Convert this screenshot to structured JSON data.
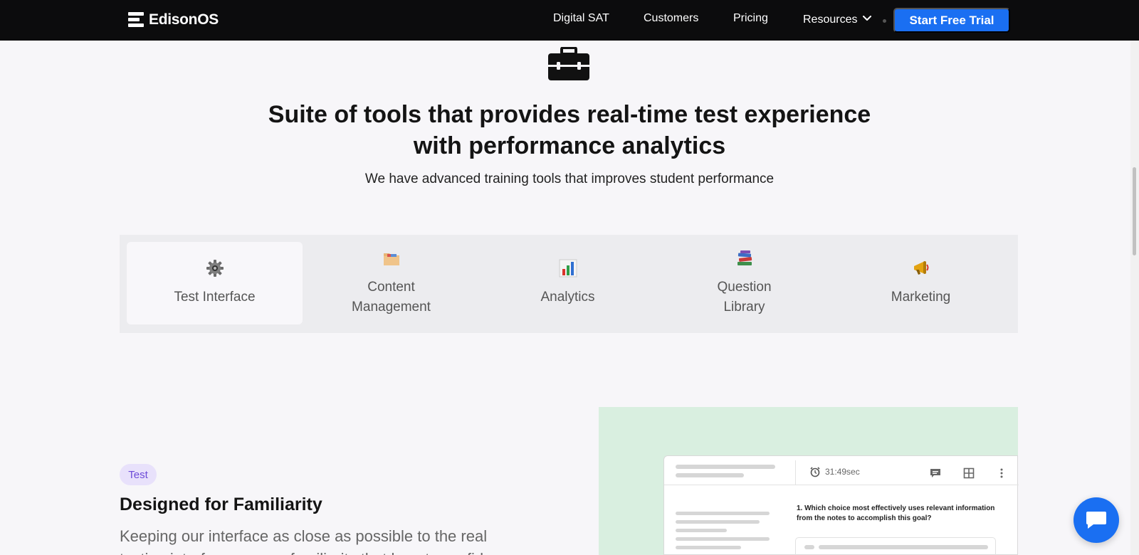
{
  "brand": {
    "name": "EdisonOS"
  },
  "nav": {
    "links": [
      "Digital SAT",
      "Customers",
      "Pricing",
      "Resources"
    ],
    "cta_label": "Start Free Trial"
  },
  "hero": {
    "headline_line1": "Suite of tools that provides real-time test experience",
    "headline_line2": "with performance analytics",
    "subheadline": "We have advanced training tools that improves student performance"
  },
  "tabs": [
    {
      "label_line1": "Test Interface",
      "label_line2": "",
      "icon": "gear-icon",
      "active": true
    },
    {
      "label_line1": "Content",
      "label_line2": "Management",
      "icon": "folder-icon",
      "active": false
    },
    {
      "label_line1": "Analytics",
      "label_line2": "",
      "icon": "bar-chart-icon",
      "active": false
    },
    {
      "label_line1": "Question",
      "label_line2": "Library",
      "icon": "books-icon",
      "active": false
    },
    {
      "label_line1": "Marketing",
      "label_line2": "",
      "icon": "megaphone-icon",
      "active": false
    }
  ],
  "feature": {
    "tag": "Test",
    "title": "Designed for Familiarity",
    "body": "Keeping our interface as close as possible to the real testing interface so your familiarity that boosts confidence"
  },
  "preview": {
    "timer": "31:49sec",
    "question": "1. Which choice most effectively uses relevant information from the notes to accomplish this goal?"
  },
  "colors": {
    "accent": "#1a6ff2",
    "nav_bg": "#0c0c0d",
    "tag_bg": "#e8e1fb",
    "tag_text": "#6d4bd8",
    "preview_bg": "#d9efe0"
  }
}
